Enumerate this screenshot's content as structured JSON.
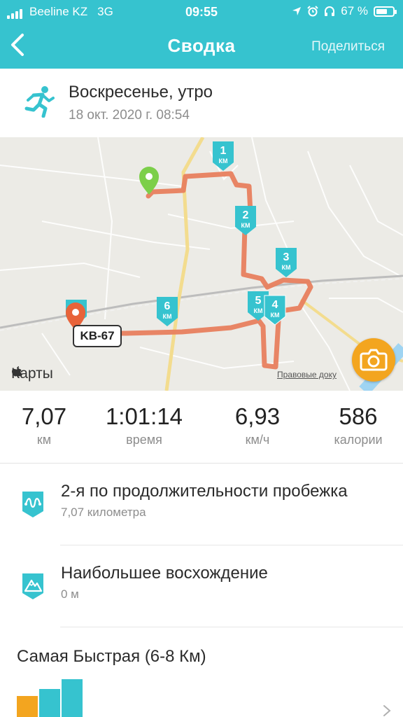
{
  "status_bar": {
    "carrier": "Beeline KZ",
    "network": "3G",
    "time": "09:55",
    "battery": "67 %",
    "battery_level": 0.67
  },
  "header": {
    "title": "Сводка",
    "share_label": "Поделиться",
    "background": "#36c3cf"
  },
  "activity": {
    "title": "Воскресенье, утро",
    "date": "18 окт. 2020 г. 08:54",
    "icon": "runner-icon"
  },
  "map": {
    "attribution": "Карты",
    "legal": "Правовые доку",
    "road_label": "KB-67",
    "km_label": "КМ",
    "markers": [
      "1",
      "2",
      "3",
      "4",
      "5",
      "6",
      "7"
    ],
    "route_color": "#e8805e",
    "marker_color": "#36c3cf",
    "start_color": "#7ccf4a",
    "end_color": "#e8633a",
    "camera_color": "#f3a51f"
  },
  "stats": [
    {
      "value": "7,07",
      "label": "км"
    },
    {
      "value": "1:01:14",
      "label": "время"
    },
    {
      "value": "6,93",
      "label": "км/ч"
    },
    {
      "value": "586",
      "label": "калории"
    }
  ],
  "achievements": [
    {
      "title": "2-я по продолжительности пробежка",
      "subtitle": "7,07 километра",
      "icon": "route-badge-icon"
    },
    {
      "title": "Наибольшее восхождение",
      "subtitle": "0 м",
      "icon": "mountain-badge-icon"
    }
  ],
  "fastest": {
    "title": "Самая Быстрая (6-8 Км)",
    "bar_colors": [
      "#f3a51f",
      "#36c3cf",
      "#36c3cf"
    ]
  }
}
